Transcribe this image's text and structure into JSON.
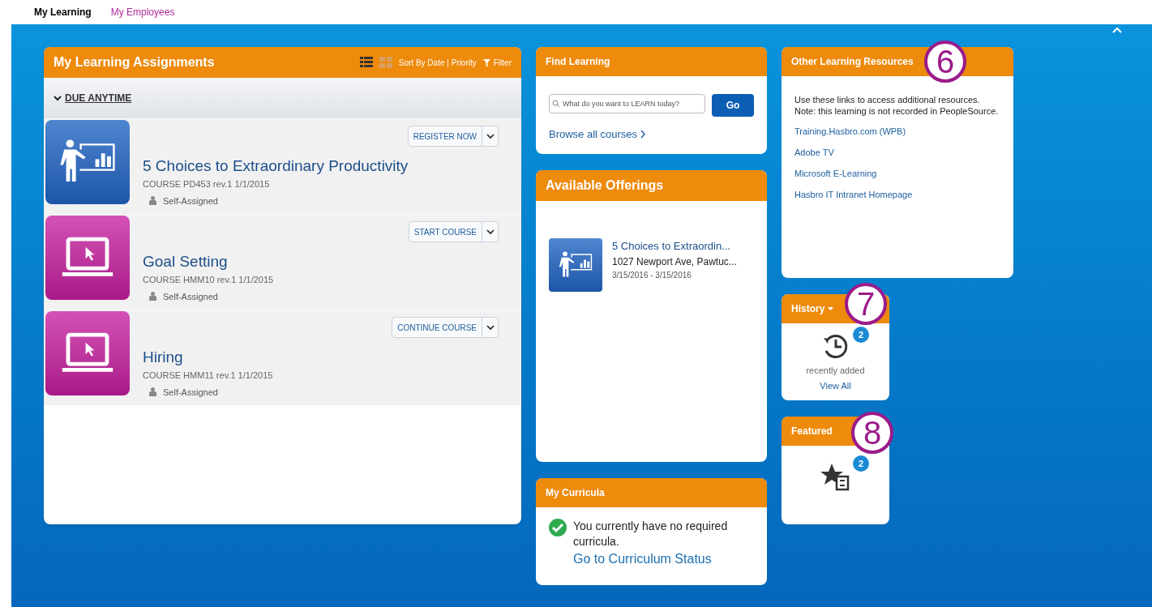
{
  "tabs": [
    {
      "label": "My Learning",
      "selected": true
    },
    {
      "label": "My Employees",
      "selected": false
    }
  ],
  "assignments": {
    "title": "My Learning Assignments",
    "view_modes": [
      {
        "kind": "list",
        "selected": true
      },
      {
        "kind": "grid",
        "selected": false
      }
    ],
    "sort": "Sort By Date | Priority",
    "filter": "Filter",
    "group": "DUE ANYTIME",
    "courses": [
      {
        "kind": "presenter",
        "title": "5 Choices to Extraordinary Productivity",
        "meta": "COURSE PD453 rev.1 1/1/2015",
        "assigned": "Self-Assigned",
        "action": "REGISTER NOW"
      },
      {
        "kind": "laptop",
        "title": "Goal Setting",
        "meta": "COURSE HMM10 rev.1 1/1/2015",
        "assigned": "Self-Assigned",
        "action": "START COURSE"
      },
      {
        "kind": "laptop",
        "title": "Hiring",
        "meta": "COURSE HMM11 rev.1 1/1/2015",
        "assigned": "Self-Assigned",
        "action": "CONTINUE COURSE"
      }
    ]
  },
  "find": {
    "title": "Find Learning",
    "placeholder": "What do you want to LEARN today?",
    "button": "Go",
    "browse": "Browse all courses"
  },
  "offerings": {
    "title": "Available Offerings",
    "items": [
      {
        "title": "5 Choices to Extraordin...",
        "location": "1027 Newport Ave, Pawtuc...",
        "dates": "3/15/2016 - 3/15/2016"
      }
    ]
  },
  "curricula": {
    "title": "My Curricula",
    "message": "You currently have no required curricula.",
    "link": "Go to Curriculum Status"
  },
  "resources": {
    "title": "Other Learning Resources",
    "callout": "6",
    "note": "Use these links to access additional resources. Note: this learning is not recorded in PeopleSource.",
    "links": [
      "Training.Hasbro.com (WPB)",
      "Adobe TV",
      "Microsoft E-Learning",
      "Hasbro IT Intranet Homepage"
    ]
  },
  "history": {
    "title": "History",
    "callout": "7",
    "count": "2",
    "caption": "recently added",
    "link": "View All"
  },
  "featured": {
    "title": "Featured",
    "callout": "8",
    "count": "2"
  }
}
